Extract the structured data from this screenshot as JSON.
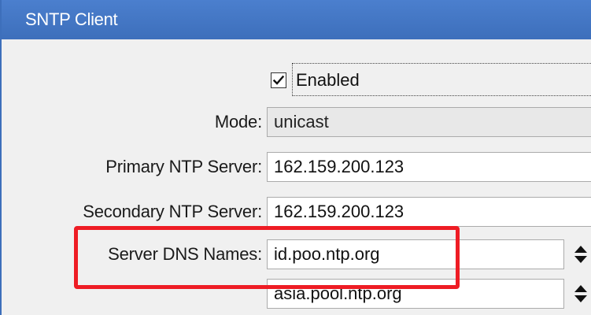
{
  "window": {
    "title": "SNTP Client"
  },
  "form": {
    "enabled": {
      "label": "Enabled",
      "checked": true
    },
    "mode": {
      "label": "Mode:",
      "value": "unicast"
    },
    "primary_ntp_server": {
      "label": "Primary NTP Server:",
      "value": "162.159.200.123"
    },
    "secondary_ntp_server": {
      "label": "Secondary NTP Server:",
      "value": "162.159.200.123"
    },
    "server_dns_names": {
      "label": "Server DNS Names:",
      "values": [
        "id.poo.ntp.org",
        "asia.pool.ntp.org"
      ]
    }
  },
  "colors": {
    "titlebar": "#3d6fbb",
    "highlight": "#ee1c24",
    "background": "#f0f0f0"
  },
  "icons": {
    "checkbox": "checkmark-icon",
    "spinner": "up-down-arrows-icon"
  }
}
